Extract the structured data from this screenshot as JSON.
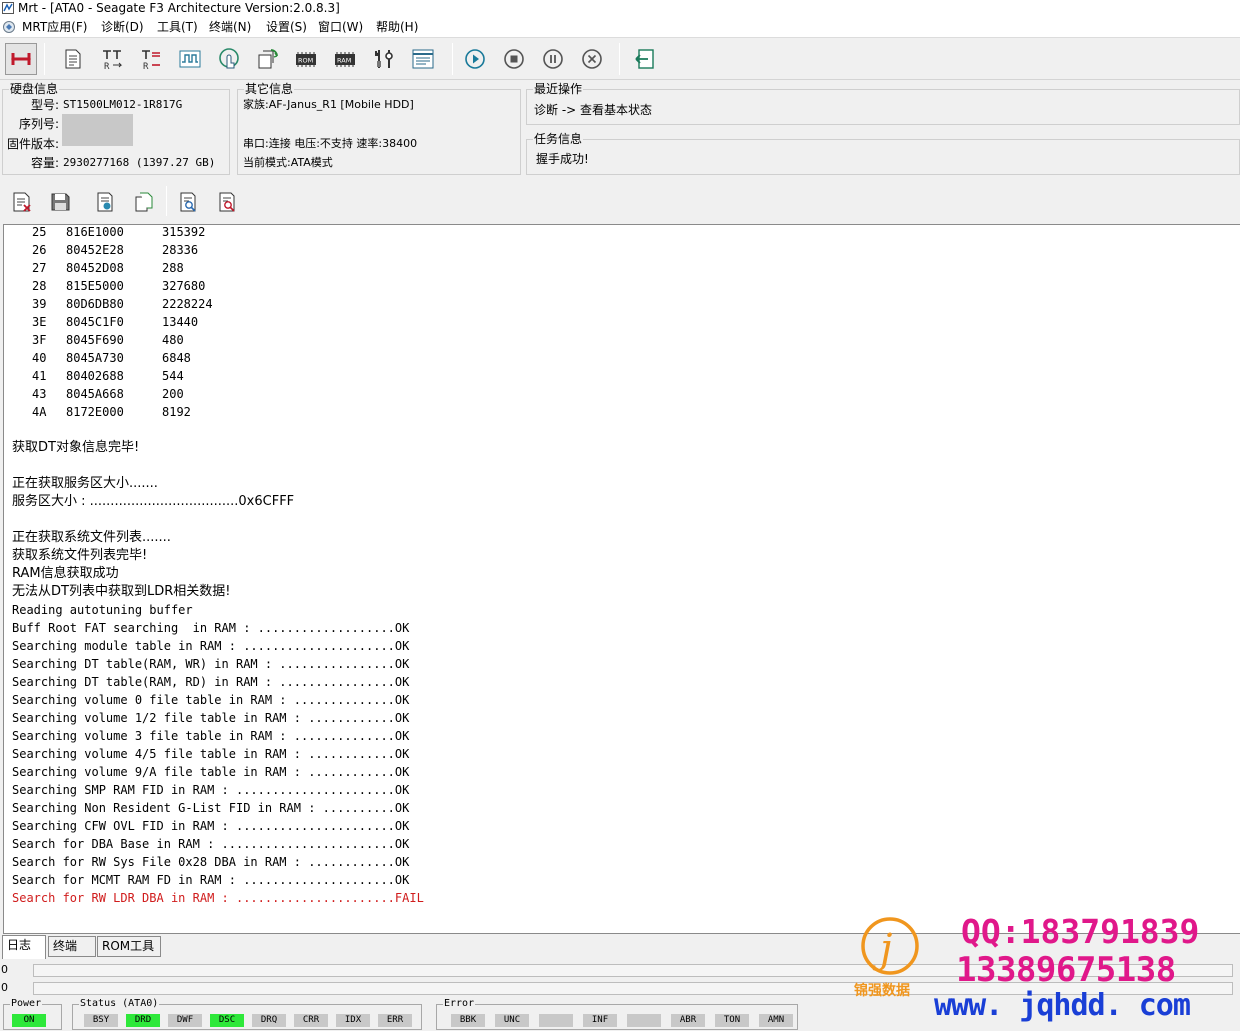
{
  "window": {
    "title": "Mrt - [ATA0 - Seagate F3 Architecture Version:2.0.8.3]"
  },
  "menu": [
    "MRT应用(F)",
    "诊断(D)",
    "工具(T)",
    "终端(N)",
    "设置(S)",
    "窗口(W)",
    "帮助(H)"
  ],
  "toolbar": {
    "buttons": [
      "connect",
      "document",
      "read-register",
      "terminal-register",
      "waveform",
      "touch",
      "copy-rotate",
      "rom",
      "ram",
      "tools",
      "checklist",
      "play",
      "stop",
      "pause",
      "cancel",
      "exit"
    ],
    "rom_label": "ROM",
    "ram_label": "RAM"
  },
  "disk_info": {
    "title": "硬盘信息",
    "model_label": "型号:",
    "model": "ST1500LM012-1R817G",
    "serial_label": "序列号:",
    "serial": "",
    "firmware_label": "固件版本:",
    "firmware": "",
    "capacity_label": "容量:",
    "capacity": "2930277168 (1397.27 GB)"
  },
  "other_info": {
    "title": "其它信息",
    "family": "家族:AF-Janus_R1 [Mobile HDD]",
    "serial_status": "串口:连接 电压:不支持 速率:38400",
    "mode": "当前模式:ATA模式"
  },
  "recent_op": {
    "title": "最近操作",
    "text": "诊断 -> 查看基本状态"
  },
  "task_info": {
    "title": "任务信息",
    "text": "握手成功!"
  },
  "dt_table": [
    {
      "id": "25",
      "addr": "816E1000",
      "size": "315392"
    },
    {
      "id": "26",
      "addr": "80452E28",
      "size": "28336"
    },
    {
      "id": "27",
      "addr": "80452D08",
      "size": "288"
    },
    {
      "id": "28",
      "addr": "815E5000",
      "size": "327680"
    },
    {
      "id": "39",
      "addr": "80D6DB80",
      "size": "2228224"
    },
    {
      "id": "3E",
      "addr": "8045C1F0",
      "size": "13440"
    },
    {
      "id": "3F",
      "addr": "8045F690",
      "size": "480"
    },
    {
      "id": "40",
      "addr": "8045A730",
      "size": "6848"
    },
    {
      "id": "41",
      "addr": "80402688",
      "size": "544"
    },
    {
      "id": "43",
      "addr": "8045A668",
      "size": "200"
    },
    {
      "id": "4A",
      "addr": "8172E000",
      "size": "8192"
    }
  ],
  "log_lines": [
    "获取DT对象信息完毕!",
    "",
    "正在获取服务区大小.......",
    "服务区大小 : ....................................0x6CFFF",
    "",
    "正在获取系统文件列表.......",
    "获取系统文件列表完毕!",
    "RAM信息获取成功",
    "无法从DT列表中获取到LDR相关数据!",
    "Reading autotuning buffer",
    "Buff Root FAT searching  in RAM : ...................OK",
    "Searching module table in RAM : .....................OK",
    "Searching DT table(RAM, WR) in RAM : ................OK",
    "Searching DT table(RAM, RD) in RAM : ................OK",
    "Searching volume 0 file table in RAM : ..............OK",
    "Searching volume 1/2 file table in RAM : ............OK",
    "Searching volume 3 file table in RAM : ..............OK",
    "Searching volume 4/5 file table in RAM : ............OK",
    "Searching volume 9/A file table in RAM : ............OK",
    "Searching SMP RAM FID in RAM : ......................OK",
    "Searching Non Resident G-List FID in RAM : ..........OK",
    "Searching CFW OVL FID in RAM : ......................OK",
    "Search for DBA Base in RAM : ........................OK",
    "Search for RW Sys File 0x28 DBA in RAM : ............OK",
    "Search for MCMT RAM FD in RAM : .....................OK",
    "Search for RW LDR DBA in RAM : ......................FAIL"
  ],
  "tabs": [
    "日志",
    "终端",
    "ROM工具"
  ],
  "progress": [
    "0",
    "0"
  ],
  "status_panels": {
    "power_title": "Power",
    "power": [
      {
        "label": "ON",
        "on": true
      }
    ],
    "status_title": "Status (ATA0)",
    "status": [
      {
        "label": "BSY",
        "on": false
      },
      {
        "label": "DRD",
        "on": true
      },
      {
        "label": "DWF",
        "on": false
      },
      {
        "label": "DSC",
        "on": true
      },
      {
        "label": "DRQ",
        "on": false
      },
      {
        "label": "CRR",
        "on": false
      },
      {
        "label": "IDX",
        "on": false
      },
      {
        "label": "ERR",
        "on": false
      }
    ],
    "error_title": "Error",
    "error": [
      {
        "label": "BBK",
        "on": false
      },
      {
        "label": "UNC",
        "on": false
      },
      {
        "label": "",
        "on": false
      },
      {
        "label": "INF",
        "on": false
      },
      {
        "label": "",
        "on": false
      },
      {
        "label": "ABR",
        "on": false
      },
      {
        "label": "TON",
        "on": false
      },
      {
        "label": "AMN",
        "on": false
      }
    ]
  },
  "watermark": {
    "qq": "QQ:183791839",
    "phone": "13389675138",
    "url": "www. jqhdd. com",
    "brand": "锦强数据",
    "logo_letter": "j"
  },
  "colors": {
    "fail_text": "#d01c1c",
    "indicator_on": "#2ee83a",
    "watermark_magenta": "#e0188a",
    "watermark_blue": "#1a3fd6",
    "logo_orange": "#f0961e"
  }
}
